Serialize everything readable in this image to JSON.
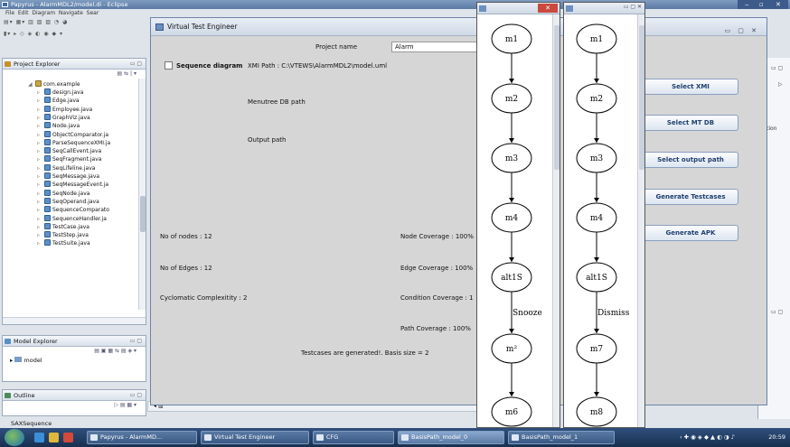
{
  "eclipse": {
    "title": "Papyrus - AlarmMDL2/model.di - Eclipse",
    "menu": [
      "File",
      "Edit",
      "Diagram",
      "Navigate",
      "Sear"
    ],
    "project_explorer": {
      "title": "Project Explorer",
      "package": "com.example",
      "files": [
        "design.java",
        "Edge.java",
        "Employee.java",
        "GraphViz.java",
        "Node.java",
        "ObjectComparator.ja",
        "ParseSequenceXMI.ja",
        "SeqCallEvent.java",
        "SeqFragment.java",
        "SeqLifeline.java",
        "SeqMessage.java",
        "SeqMessageEvent.ja",
        "SeqNode.java",
        "SeqOperand.java",
        "SequenceComparato",
        "SequenceHandler.ja",
        "TestCase.java",
        "TestStep.java",
        "TestSuite.java"
      ]
    },
    "model_explorer": {
      "title": "Model Explorer",
      "item": "model"
    },
    "outline": {
      "title": "Outline"
    },
    "status": "SAXSequence",
    "right_edge": {
      "text1": "cation",
      "text2": "nt"
    }
  },
  "vte": {
    "title": "Virtual Test Engineer",
    "project_name_label": "Project name",
    "project_name_value": "Alarm",
    "sequence_diagram_label": "Sequence diagram",
    "xmi_path": "XMI Path : C:\\VTEWS\\AlarmMDL2\\model.uml",
    "menutree_label": "Menutree DB path",
    "output_label": "Output path",
    "nodes": "No of nodes : 12",
    "edges": "No of Edges : 12",
    "cyclomatic": "Cyclomatic Complexitity : 2",
    "node_cov": "Node Coverage : 100%",
    "edge_cov": "Edge Coverage : 100%",
    "cond_cov": "Condition Coverage : 1",
    "path_cov": "Path Coverage : 100%",
    "result": "Testcases are generated!. Basis size = 2",
    "buttons": {
      "select_xmi": "Select XMI",
      "select_mt": "Select MT DB",
      "select_output": "Select output path",
      "generate_tc": "Generate Testcases",
      "generate_apk": "Generate APK"
    }
  },
  "cfg0": {
    "nodes": [
      "m1",
      "m2",
      "m3",
      "m4",
      "alt1S",
      "m²",
      "m6"
    ],
    "edge_label": "Snooze"
  },
  "cfg1": {
    "nodes": [
      "m1",
      "m2",
      "m3",
      "m4",
      "alt1S",
      "m7",
      "m8"
    ],
    "edge_label": "Dismiss"
  },
  "taskbar": {
    "tasks": [
      "Papyrus - AlarmMD...",
      "Virtual Test Engineer",
      "CFG",
      "BasisPath_model_0",
      "BasisPath_model_1"
    ],
    "clock": "20:59"
  }
}
